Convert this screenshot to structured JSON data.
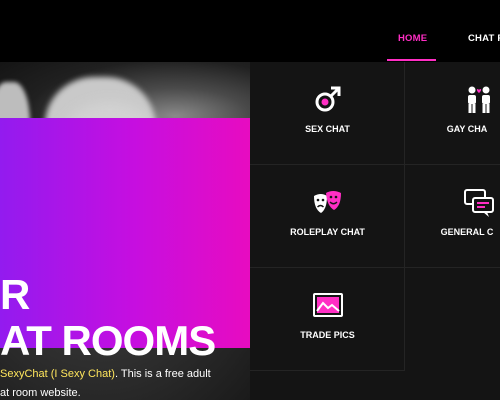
{
  "nav": {
    "items": [
      {
        "label": "HOME",
        "active": true
      },
      {
        "label": "CHAT R"
      }
    ]
  },
  "hero": {
    "title_line1": "R",
    "title_line2": "AT ROOMS",
    "text_line1_prefix": "",
    "text_line1_highlight": "SexyChat (I Sexy Chat)",
    "text_line1_suffix": ". This is a free adult",
    "text_line2": "at room website."
  },
  "rooms": [
    {
      "label": "SEX CHAT",
      "icon": "gender-icon"
    },
    {
      "label": "GAY CHA",
      "icon": "couple-icon"
    },
    {
      "label": "ROLEPLAY CHAT",
      "icon": "theater-masks-icon"
    },
    {
      "label": "GENERAL C",
      "icon": "chat-bubbles-icon"
    },
    {
      "label": "TRADE PICS",
      "icon": "picture-icon"
    }
  ],
  "colors": {
    "accent": "#ff2ec4",
    "gradient_start": "#8f1cf0",
    "gradient_end": "#e80cc0",
    "highlight": "#ffe65c"
  }
}
